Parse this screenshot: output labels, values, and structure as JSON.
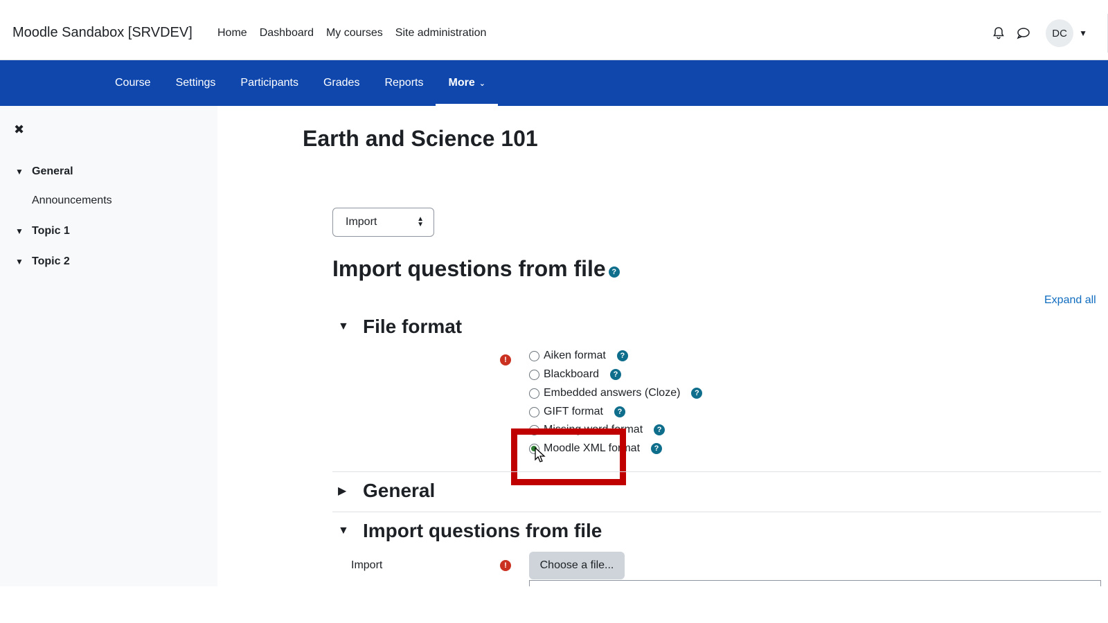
{
  "topbar": {
    "brand": "Moodle Sandabox [SRVDEV]",
    "nav": [
      "Home",
      "Dashboard",
      "My courses",
      "Site administration"
    ],
    "icons": [
      "bell-icon",
      "chat-icon"
    ],
    "avatar": "DC"
  },
  "secondary_nav": {
    "items": [
      "Course",
      "Settings",
      "Participants",
      "Grades",
      "Reports"
    ],
    "more": "More"
  },
  "sidebar": {
    "close": "✖",
    "sections": [
      {
        "label": "General",
        "items": [
          "Announcements"
        ]
      },
      {
        "label": "Topic 1",
        "items": []
      },
      {
        "label": "Topic 2",
        "items": []
      }
    ]
  },
  "main": {
    "page_title": "Earth and Science 101",
    "action_select": "Import",
    "heading": "Import questions from file",
    "expand_all": "Expand all",
    "file_format": {
      "title": "File format",
      "options": [
        "Aiken format",
        "Blackboard",
        "Embedded answers (Cloze)",
        "GIFT format",
        "Missing word format",
        "Moodle XML format"
      ],
      "selected": "Moodle XML format"
    },
    "general_title": "General",
    "import_section": {
      "title": "Import questions from file",
      "label": "Import",
      "button": "Choose a file..."
    }
  },
  "colors": {
    "primary_nav": "#0f47ad",
    "link": "#0f6cbf",
    "error": "#ca3120",
    "highlight": "#c00000"
  }
}
